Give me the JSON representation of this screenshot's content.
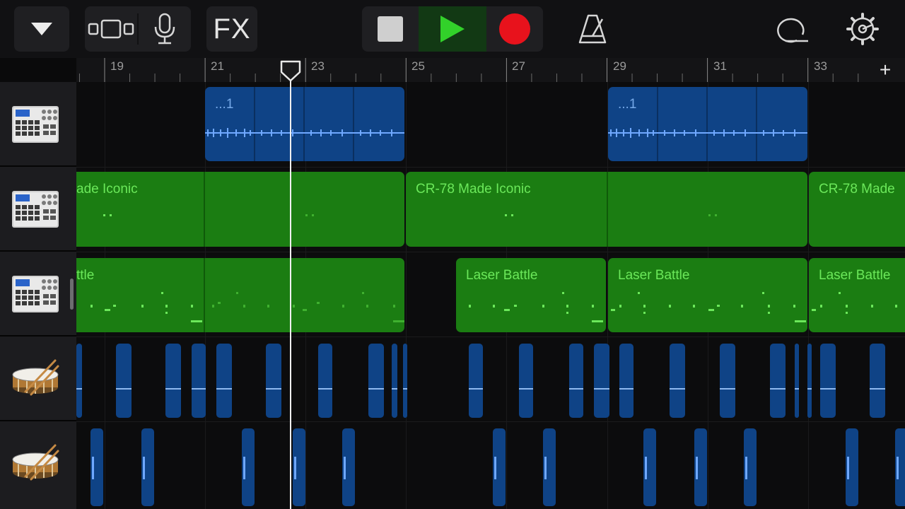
{
  "toolbar": {
    "fx_label": "FX",
    "icons": [
      "chevron-down-icon",
      "tracks-view-icon",
      "microphone-icon",
      "stop-icon",
      "play-icon",
      "record-icon",
      "metronome-icon",
      "loop-browser-icon",
      "settings-gear-icon"
    ]
  },
  "ruler": {
    "bars": [
      "19",
      "21",
      "23",
      "25",
      "27",
      "29",
      "31",
      "33"
    ],
    "add_label": "+"
  },
  "tracks": [
    {
      "name": "drum-machine-1",
      "icon": "drum-machine-icon"
    },
    {
      "name": "drum-machine-2",
      "icon": "drum-machine-icon"
    },
    {
      "name": "drum-machine-3",
      "icon": "drum-machine-icon"
    },
    {
      "name": "snare-1",
      "icon": "snare-drum-icon"
    },
    {
      "name": "snare-2",
      "icon": "snare-drum-icon"
    }
  ],
  "regions": {
    "track1": [
      "...1",
      "...1"
    ],
    "track2": [
      "ade Iconic",
      "CR-78 Made Iconic",
      "CR-78 Made"
    ],
    "track3": [
      "ttle",
      "Laser Battle",
      "Laser Battle",
      "Laser Battle"
    ]
  },
  "colors": {
    "audio_region": "#0f4386",
    "midi_region": "#1b7d12",
    "play_active": "#32d12a",
    "record": "#e8121c"
  }
}
